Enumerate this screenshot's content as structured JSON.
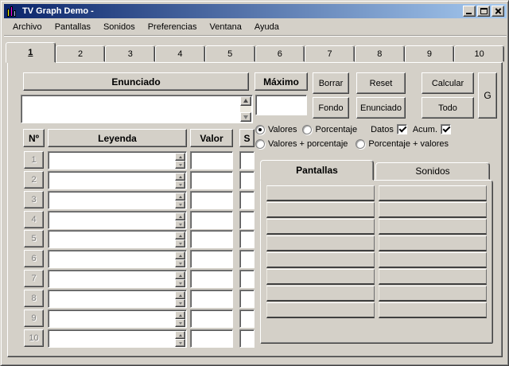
{
  "window": {
    "title": "TV Graph Demo -",
    "icons": {
      "app": "bar-chart-icon",
      "minimize": "minimize-icon",
      "maximize": "maximize-icon",
      "close": "close-icon"
    }
  },
  "colors": {
    "titlebar_left": "#0a246a",
    "titlebar_right": "#a6caf0",
    "face": "#d4d0c8",
    "input_bg": "#ffffff"
  },
  "menu": {
    "items": [
      "Archivo",
      "Pantallas",
      "Sonidos",
      "Preferencias",
      "Ventana",
      "Ayuda"
    ]
  },
  "tabs": {
    "items": [
      "1",
      "2",
      "3",
      "4",
      "5",
      "6",
      "7",
      "8",
      "9",
      "10"
    ],
    "active": "1"
  },
  "enunciado": {
    "header": "Enunciado",
    "value": ""
  },
  "maximo": {
    "label": "Máximo",
    "value": ""
  },
  "actions": {
    "borrar": "Borrar",
    "reset": "Reset",
    "calcular": "Calcular",
    "fondo": "Fondo",
    "enunciado": "Enunciado",
    "todo": "Todo",
    "g": "G"
  },
  "options": {
    "radios": [
      {
        "label": "Valores",
        "selected": true
      },
      {
        "label": "Porcentaje",
        "selected": false
      },
      {
        "label": "Valores + porcentaje",
        "selected": false
      },
      {
        "label": "Porcentaje + valores",
        "selected": false
      }
    ],
    "checkboxes": [
      {
        "label": "Datos",
        "checked": true
      },
      {
        "label": "Acum.",
        "checked": true
      }
    ]
  },
  "table": {
    "headers": {
      "num": "Nº",
      "leyenda": "Leyenda",
      "valor": "Valor",
      "s": "S"
    },
    "rows": [
      {
        "num": "1",
        "leyenda": "",
        "valor": "",
        "s": ""
      },
      {
        "num": "2",
        "leyenda": "",
        "valor": "",
        "s": ""
      },
      {
        "num": "3",
        "leyenda": "",
        "valor": "",
        "s": ""
      },
      {
        "num": "4",
        "leyenda": "",
        "valor": "",
        "s": ""
      },
      {
        "num": "5",
        "leyenda": "",
        "valor": "",
        "s": ""
      },
      {
        "num": "6",
        "leyenda": "",
        "valor": "",
        "s": ""
      },
      {
        "num": "7",
        "leyenda": "",
        "valor": "",
        "s": ""
      },
      {
        "num": "8",
        "leyenda": "",
        "valor": "",
        "s": ""
      },
      {
        "num": "9",
        "leyenda": "",
        "valor": "",
        "s": ""
      },
      {
        "num": "10",
        "leyenda": "",
        "valor": "",
        "s": ""
      }
    ]
  },
  "subtabs": {
    "items": [
      "Pantallas",
      "Sonidos"
    ],
    "active": "Pantallas",
    "grid": {
      "rows": 8,
      "cols": 2
    }
  }
}
